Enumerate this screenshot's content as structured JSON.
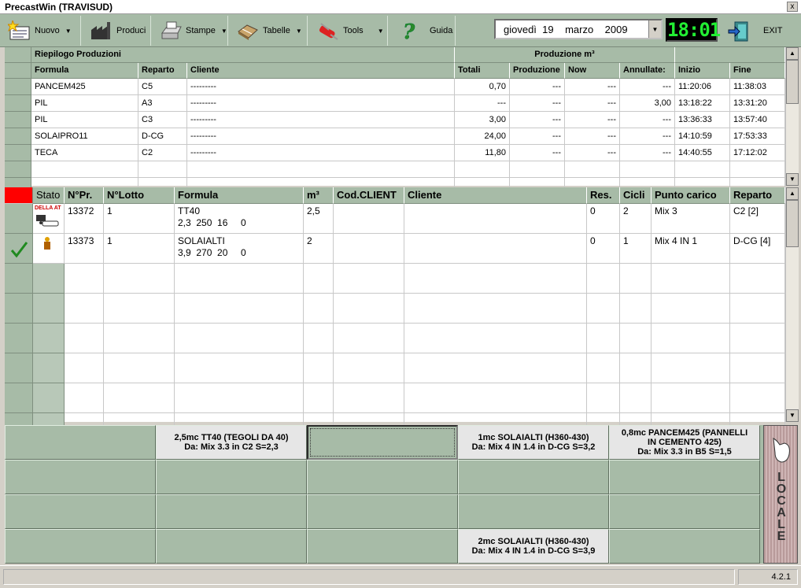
{
  "window": {
    "title": "PrecastWin (TRAVISUD)",
    "close": "x"
  },
  "toolbar": {
    "nuovo": "Nuovo",
    "produci": "Produci",
    "stampe": "Stampe",
    "tabelle": "Tabelle",
    "tools": "Tools",
    "guida": "Guida",
    "exit": "EXIT"
  },
  "date": {
    "weekday": "giovedì",
    "day": "19",
    "month": "marzo",
    "year": "2009"
  },
  "clock": "18:01",
  "summary": {
    "title": "Riepilogo Produzioni",
    "group_title": "Produzione  m³",
    "headers": [
      "Formula",
      "Reparto",
      "Cliente",
      "Totali",
      "Produzione",
      "Now",
      "Annullate:",
      "Inizio",
      "Fine"
    ],
    "rows": [
      [
        "PANCEM425",
        "C5",
        "---------",
        "0,70",
        "---",
        "---",
        "---",
        "11:20:06",
        "11:38:03"
      ],
      [
        "PIL",
        "A3",
        "---------",
        "---",
        "---",
        "---",
        "3,00",
        "13:18:22",
        "13:31:20"
      ],
      [
        "PIL",
        "C3",
        "---------",
        "3,00",
        "---",
        "---",
        "---",
        "13:36:33",
        "13:57:40"
      ],
      [
        "SOLAIPRO11",
        "D-CG",
        "---------",
        "24,00",
        "---",
        "---",
        "---",
        "14:10:59",
        "17:53:33"
      ],
      [
        "TECA",
        "C2",
        "---------",
        "11,80",
        "---",
        "---",
        "---",
        "14:40:55",
        "17:12:02"
      ]
    ]
  },
  "orders": {
    "headers": [
      "Stato",
      "N°Pr.",
      "N°Lotto",
      "Formula",
      "m³",
      "Cod.CLIENT",
      "Cliente",
      "Res.",
      "Cicli",
      "Punto carico",
      "Reparto"
    ],
    "rows": [
      {
        "np": "13372",
        "lotto": "1",
        "formula": "TT40",
        "detail": "2,3  250  16     0",
        "m3": "2,5",
        "cod": "",
        "cliente": "",
        "res": "0",
        "cicli": "2",
        "punto": "Mix 3",
        "reparto": "C2  [2]",
        "stato_icon": "DELLA AT"
      },
      {
        "np": "13373",
        "lotto": "1",
        "formula": "SOLAIALTI",
        "detail": "3,9  270  20     0",
        "m3": "2",
        "cod": "",
        "cliente": "",
        "res": "0",
        "cicli": "1",
        "punto": "Mix 4 IN 1",
        "reparto": "D-CG  [4]"
      }
    ]
  },
  "panel": {
    "c1": {
      "l1": "2,5mc TT40 (TEGOLI DA 40)",
      "l2": "Da: Mix 3.3 in C2 S=2,3"
    },
    "c3": {
      "l1": "1mc SOLAIALTI (H360-430)",
      "l2": "Da: Mix 4 IN 1.4 in D-CG S=3,2"
    },
    "c4": {
      "l1": "0,8mc PANCEM425 (PANNELLI",
      "l1b": "IN CEMENTO 425)",
      "l2": "Da: Mix 3.3 in B5 S=1,5"
    },
    "c5": {
      "l1": "2mc SOLAIALTI (H360-430)",
      "l2": "Da: Mix 4 IN 1.4 in D-CG S=3,9"
    },
    "locale": "LOCALE"
  },
  "status": {
    "version": "4.2.1"
  }
}
